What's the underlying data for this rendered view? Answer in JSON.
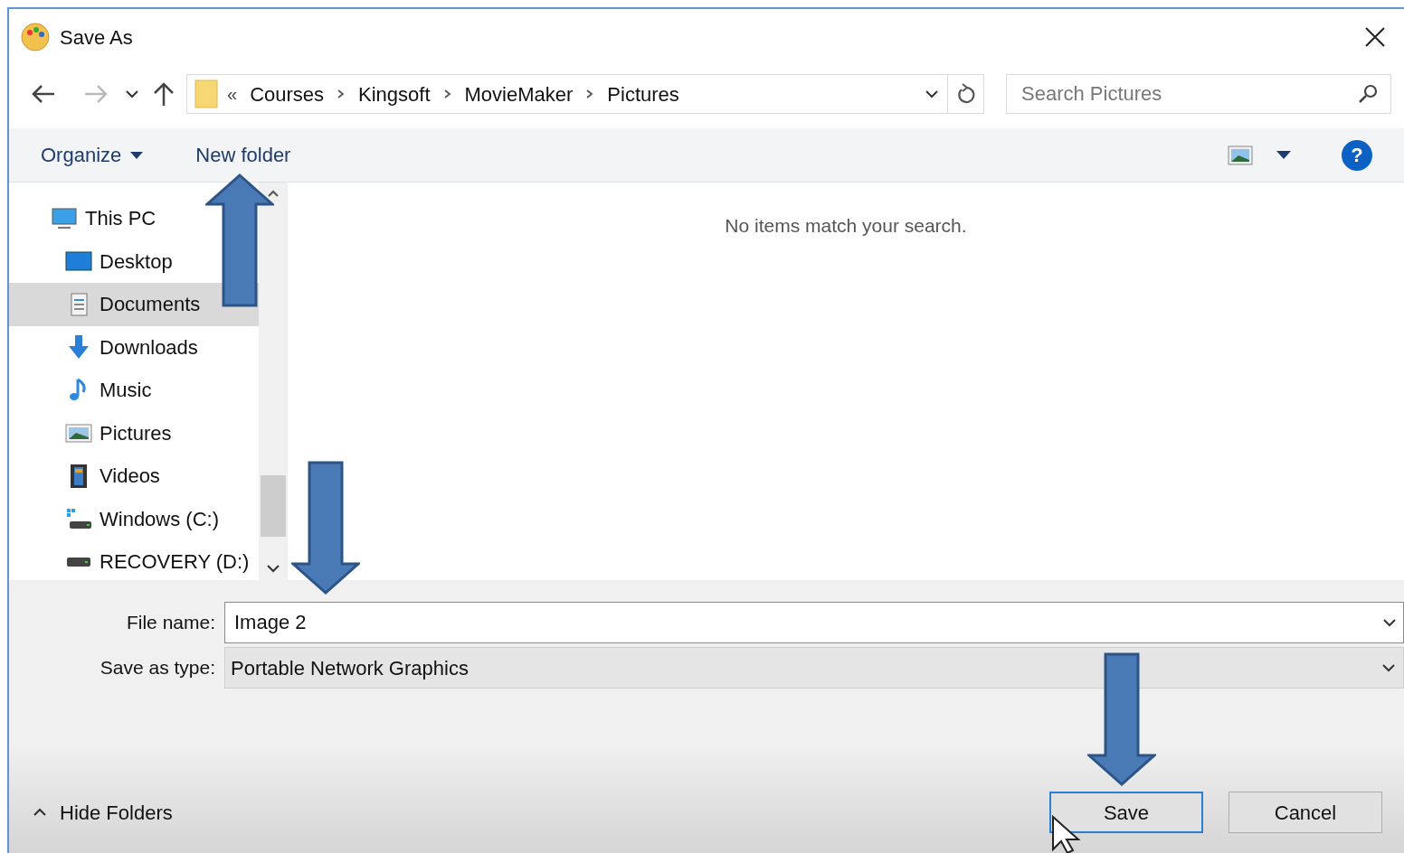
{
  "window": {
    "title": "Save As"
  },
  "address_bar": {
    "overflow": "«",
    "crumbs": [
      "Courses",
      "Kingsoft",
      "MovieMaker",
      "Pictures"
    ]
  },
  "search": {
    "placeholder": "Search Pictures"
  },
  "toolbar": {
    "organize": "Organize",
    "new_folder": "New folder",
    "help": "?"
  },
  "sidebar": {
    "items": [
      {
        "label": "This PC",
        "kind": "pc",
        "selected": false,
        "children": [
          {
            "label": "Desktop",
            "kind": "desktop",
            "selected": false
          },
          {
            "label": "Documents",
            "kind": "documents",
            "selected": true
          },
          {
            "label": "Downloads",
            "kind": "downloads",
            "selected": false
          },
          {
            "label": "Music",
            "kind": "music",
            "selected": false
          },
          {
            "label": "Pictures",
            "kind": "pictures",
            "selected": false
          },
          {
            "label": "Videos",
            "kind": "videos",
            "selected": false
          },
          {
            "label": "Windows (C:)",
            "kind": "windows-drive",
            "selected": false
          },
          {
            "label": "RECOVERY (D:)",
            "kind": "drive",
            "selected": false
          }
        ]
      }
    ]
  },
  "content": {
    "empty_message": "No items match your search."
  },
  "fields": [
    {
      "label": "File name:",
      "value": "Image 2",
      "kind": "editable"
    },
    {
      "label": "Save as type:",
      "value": "Portable Network Graphics",
      "kind": "select"
    }
  ],
  "hide_folders": "Hide Folders",
  "buttons": [
    {
      "label": "Save",
      "default": true
    },
    {
      "label": "Cancel",
      "default": false
    }
  ]
}
